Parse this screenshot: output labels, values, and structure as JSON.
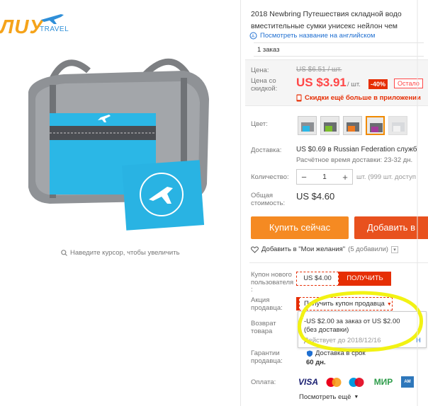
{
  "logo": {
    "mark": "ЛUУ",
    "travel": "TRAVEL"
  },
  "zoom_hint": "Наведите курсор, чтобы увеличить",
  "title": "2018 Newbring Путешествия складной водо вместительные сумки унисекс нейлон чем",
  "title_line1": "2018 Newbring Путешествия складной водо",
  "title_line2": "вместительные сумки унисекс нейлон чем",
  "translate_link": "Посмотреть название на английском",
  "orders": "1 заказ",
  "price": {
    "label_price": "Цена:",
    "old_price": "US $6.51 / шт.",
    "label_discount_1": "Цена со",
    "label_discount_2": "скидкой:",
    "new_price": "US $3.91",
    "per_unit": "/ шт.",
    "discount_badge": "-40%",
    "remaining": "Остало",
    "app_discount": "Скидки ещё больше в приложении"
  },
  "color": {
    "label": "Цвет:",
    "swatches": [
      "gray",
      "green",
      "orange",
      "purple",
      "white"
    ],
    "selected_index": 3
  },
  "shipping": {
    "label": "Доставка:",
    "value": "US $0.69 в Russian Federation служб",
    "time": "Расчётное время доставки: 23-32 дн."
  },
  "quantity": {
    "label": "Количество:",
    "minus": "−",
    "value": "1",
    "plus": "+",
    "note": "шт. (999 шт. доступ"
  },
  "total": {
    "label_1": "Общая",
    "label_2": "стоимость:",
    "value": "US $4.60"
  },
  "buttons": {
    "buy_now": "Купить сейчас",
    "add_to_cart": "Добавить в"
  },
  "wishlist": {
    "label": "Добавить в \"Мои желания\"",
    "count": "(5 добавили)"
  },
  "new_user_coupon": {
    "label_1": "Купон нового",
    "label_2": "пользователя",
    "label_3": ":",
    "value": "US $4.00",
    "button": "ПОЛУЧИТЬ"
  },
  "seller_promo": {
    "label_1": "Акция",
    "label_2": "продавца:",
    "button": "Получить купон продавца",
    "popup_line1": "-US $2.00 за заказ от US $2.00",
    "popup_line2": "(без доставки)",
    "popup_valid": "Действует до 2018/12/16",
    "popup_link": "Н"
  },
  "returns": {
    "label_1": "Возврат",
    "label_2": "товара"
  },
  "guarantee": {
    "label_1": "Гарантии",
    "label_2": "продавца:",
    "value": "Доставка в срок",
    "days": "60 дн."
  },
  "payment": {
    "label": "Оплата:",
    "methods": [
      "VISA",
      "MasterCard",
      "Maestro",
      "МИР",
      "AmEx"
    ],
    "more": "Посмотреть ещё"
  },
  "colors": {
    "price_red": "#ff4747",
    "buy_orange": "#f58a22",
    "cart_red": "#e8511e",
    "link_blue": "#1f6fd1",
    "highlight_yellow": "#f2f213"
  }
}
